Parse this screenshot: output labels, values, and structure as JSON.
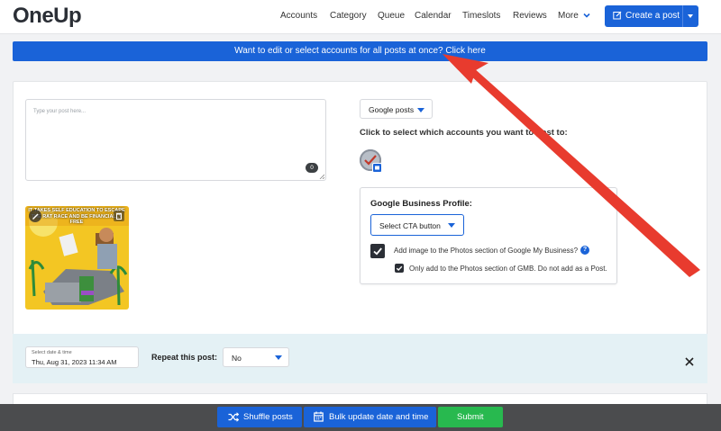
{
  "app": {
    "logo": "OneUp"
  },
  "nav": {
    "items": [
      "Accounts",
      "Category",
      "Queue",
      "Calendar",
      "Timeslots",
      "Reviews",
      "More"
    ],
    "create_label": "Create a post"
  },
  "banner": {
    "text": "Want to edit or select accounts for all posts at once? Click here"
  },
  "composer": {
    "placeholder": "Type your post here...",
    "char_count": "0",
    "thumbnail_caption": "IT TAKES SELF EDUCATION TO ESCAPE THE RAT RACE AND BE FINANCIALLY FREE"
  },
  "network_select": {
    "value": "Google posts"
  },
  "accounts": {
    "heading": "Click to select which accounts you want to post to:"
  },
  "gbp": {
    "title": "Google Business Profile:",
    "cta_value": "Select CTA button",
    "add_image_label": "Add image to the Photos section of Google My Business?",
    "help": "?",
    "only_photos_label": "Only add to the Photos section of GMB. Do not add as a Post.",
    "add_image_checked": true,
    "only_photos_checked": true
  },
  "schedule": {
    "date_label": "Select date & time",
    "date_value": "Thu, Aug 31, 2023 11:34 AM",
    "repeat_label": "Repeat this post:",
    "repeat_value": "No"
  },
  "actions": {
    "shuffle": "Shuffle posts",
    "bulk_update": "Bulk update date and time",
    "submit": "Submit"
  },
  "colors": {
    "primary": "#1a63d8",
    "submit": "#28b94f",
    "annotation": "#e83b2e",
    "schedule_bg": "#e4f1f5"
  }
}
